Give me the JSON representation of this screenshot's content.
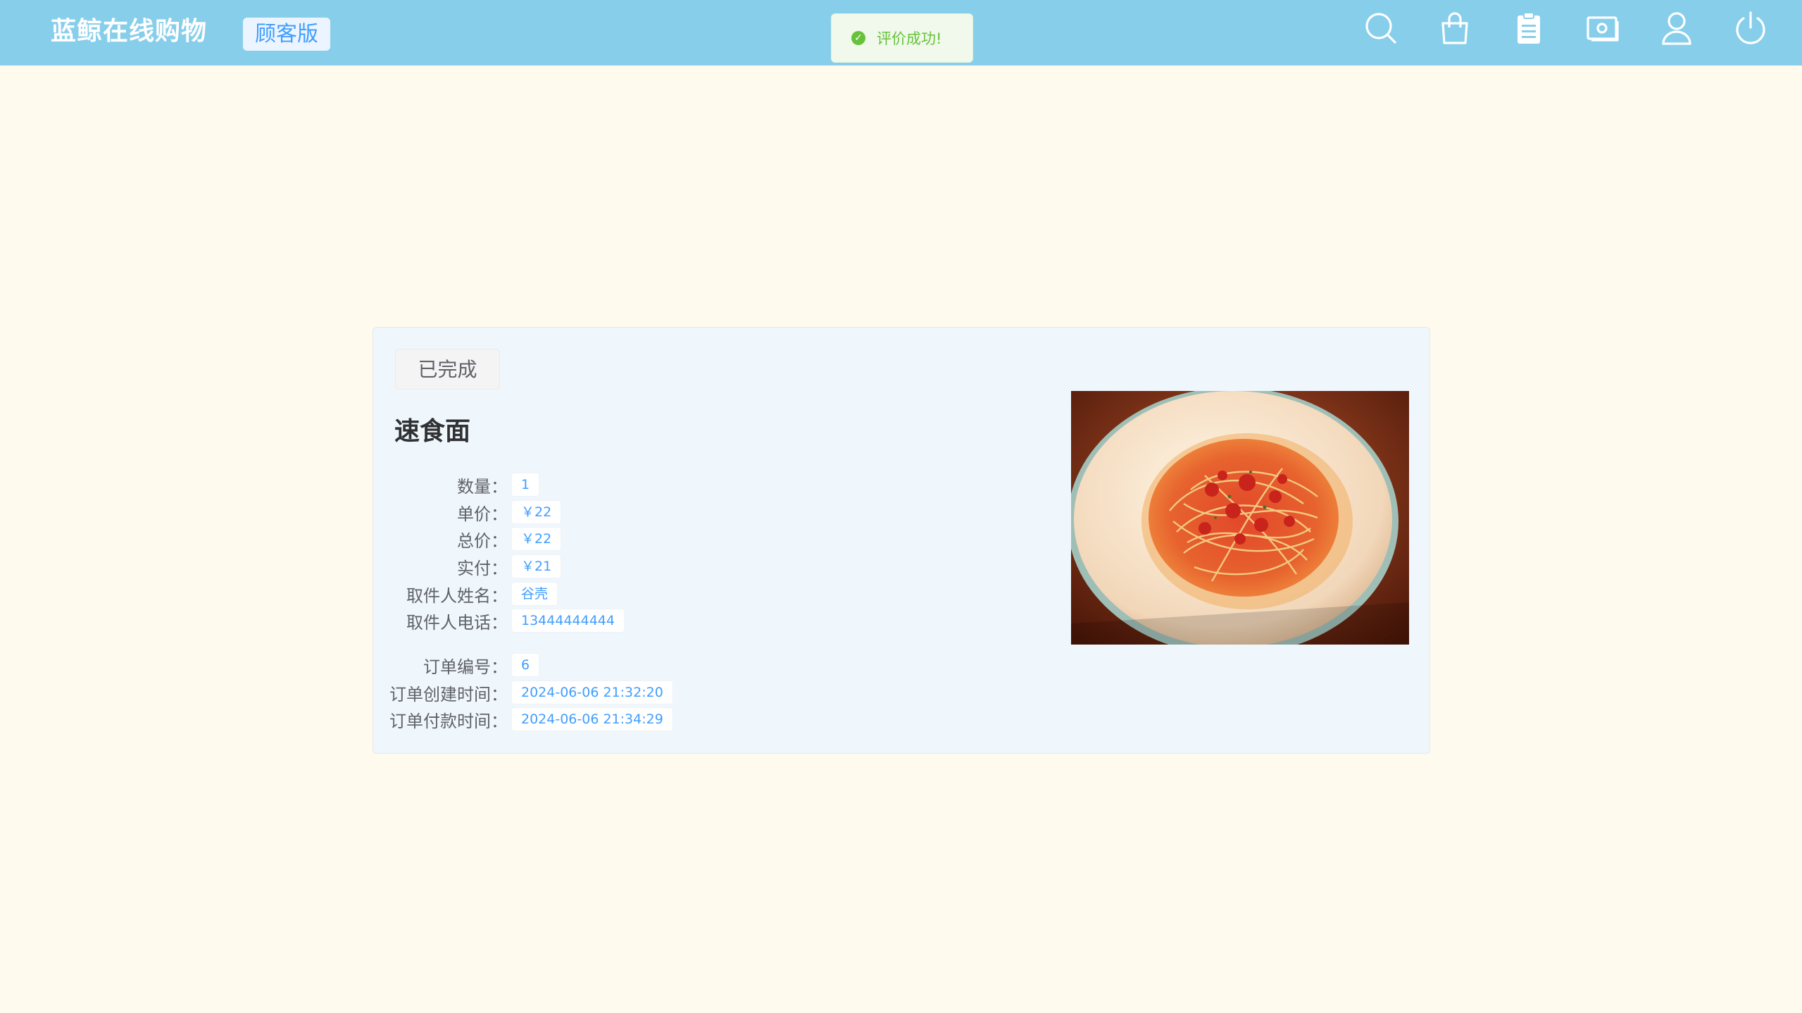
{
  "header": {
    "brand": "蓝鲸在线购物",
    "edition": "顾客版",
    "toast": "评价成功!",
    "icons": [
      "search-icon",
      "shopping-bag-icon",
      "clipboard-icon",
      "wallet-icon",
      "user-icon",
      "power-icon"
    ]
  },
  "colors": {
    "header_bg": "#87ceeb",
    "page_bg": "#fffaee",
    "card_bg": "#eff7fd",
    "accent": "#409eff",
    "success": "#67c23a"
  },
  "order": {
    "status": "已完成",
    "product_name": "速食面",
    "image": "spaghetti-dish-photo",
    "fields": [
      {
        "label": "数量：",
        "value": "1"
      },
      {
        "label": "单价：",
        "value": "￥22"
      },
      {
        "label": "总价：",
        "value": "￥22"
      },
      {
        "label": "实付：",
        "value": "￥21"
      },
      {
        "label": "取件人姓名：",
        "value": "谷壳"
      },
      {
        "label": "取件人电话：",
        "value": "13444444444"
      }
    ],
    "meta": [
      {
        "label": "订单编号：",
        "value": "6"
      },
      {
        "label": "订单创建时间：",
        "value": "2024-06-06 21:32:20"
      },
      {
        "label": "订单付款时间：",
        "value": "2024-06-06 21:34:29"
      }
    ]
  }
}
